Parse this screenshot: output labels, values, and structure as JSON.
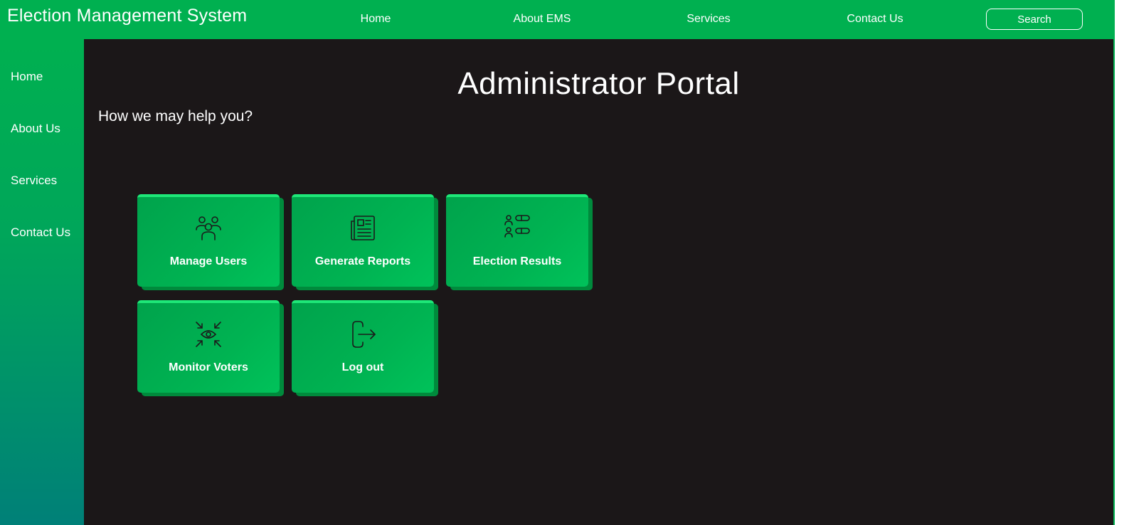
{
  "header": {
    "brand": "Election Management System",
    "nav": [
      "Home",
      "About EMS",
      "Services",
      "Contact Us"
    ],
    "search_label": "Search"
  },
  "sidebar": {
    "items": [
      "Home",
      "About Us",
      "Services",
      "Contact Us"
    ]
  },
  "main": {
    "title": "Administrator Portal",
    "subtitle": "How we may help you?",
    "cards": [
      {
        "label": "Manage Users",
        "icon": "users-icon"
      },
      {
        "label": "Generate Reports",
        "icon": "report-icon"
      },
      {
        "label": "Election Results",
        "icon": "results-icon"
      },
      {
        "label": "Monitor Voters",
        "icon": "eye-monitor-icon"
      },
      {
        "label": "Log out",
        "icon": "logout-icon"
      }
    ]
  },
  "colors": {
    "brand_green": "#00b050",
    "background": "#1b1718",
    "card_green": "#00b352",
    "text": "#ffffff"
  }
}
